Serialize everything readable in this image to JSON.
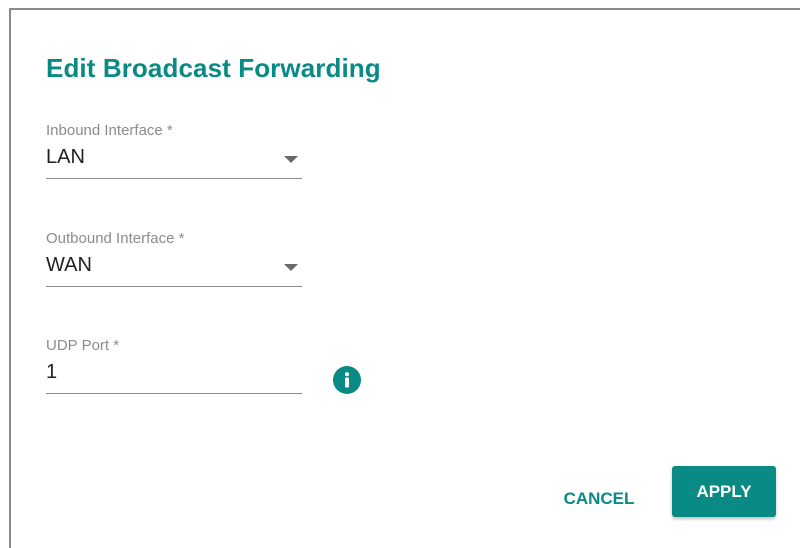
{
  "dialog": {
    "title": "Edit Broadcast Forwarding"
  },
  "fields": {
    "inbound": {
      "label": "Inbound Interface *",
      "value": "LAN"
    },
    "outbound": {
      "label": "Outbound Interface *",
      "value": "WAN"
    },
    "udp_port": {
      "label": "UDP Port *",
      "value": "1"
    }
  },
  "actions": {
    "cancel_label": "CANCEL",
    "apply_label": "APPLY"
  },
  "icons": {
    "info": "info-icon"
  },
  "colors": {
    "accent": "#0a8a84",
    "label": "#8c8c8c",
    "text": "#222222"
  }
}
